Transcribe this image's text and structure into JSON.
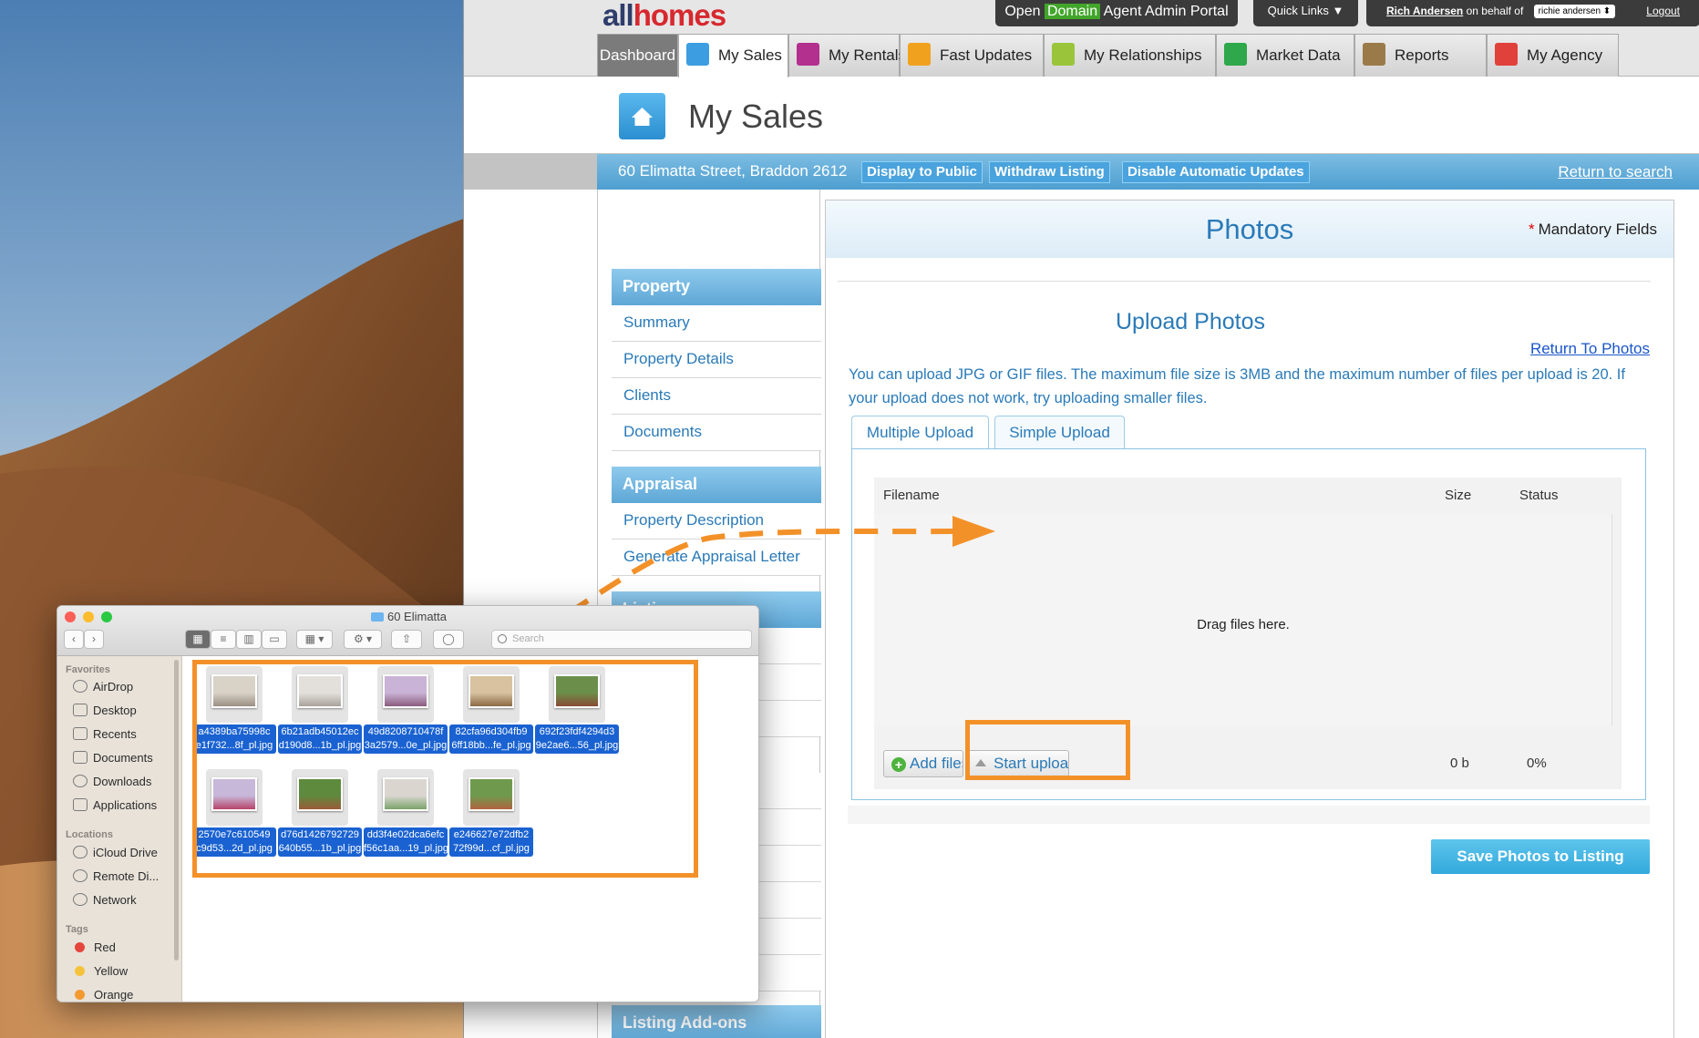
{
  "colors": {
    "accent": "#2a7ab8",
    "highlight": "#f39129",
    "brand_red": "#d7282f",
    "brand_navy": "#2f3d6b",
    "domain_green": "#41a62a",
    "selection_blue": "#1a62d1"
  },
  "brand": {
    "part1": "all",
    "part2": "homes"
  },
  "topbar": {
    "open": "Open",
    "domain": "Domain",
    "portal_rest": " Agent Admin Portal",
    "quick_links": "Quick Links ▼",
    "user": "Rich Andersen",
    "on_behalf": " on behalf of",
    "selected_user": "richie andersen ⬍",
    "logout": "Logout"
  },
  "tabs": [
    {
      "label": "Dashboard",
      "icon": "none"
    },
    {
      "label": "My Sales",
      "icon": "house-icon"
    },
    {
      "label": "My Rentals",
      "icon": "rentals-icon"
    },
    {
      "label": "Fast Updates",
      "icon": "lightning-icon"
    },
    {
      "label": "My Relationships",
      "icon": "people-icon"
    },
    {
      "label": "Market Data",
      "icon": "pie-chart-icon"
    },
    {
      "label": "Reports",
      "icon": "report-icon"
    },
    {
      "label": "My Agency",
      "icon": "agency-icon"
    }
  ],
  "page_title": "My Sales",
  "address_bar": {
    "address": "60 Elimatta Street, Braddon 2612",
    "display_public": "Display to Public",
    "withdraw": "Withdraw Listing",
    "disable_updates": "Disable Automatic Updates",
    "return_search": "Return to search"
  },
  "left_nav": {
    "property_header": "Property",
    "property_items": [
      "Summary",
      "Property Details",
      "Clients",
      "Documents"
    ],
    "appraisal_header": "Appraisal",
    "appraisal_items": [
      "Property Description",
      "Generate Appraisal Letter"
    ],
    "listing_header": "Listing",
    "addons_header": "Listing Add-ons"
  },
  "photos_panel": {
    "title": "Photos",
    "mandatory": "Mandatory Fields",
    "upload_title": "Upload Photos",
    "return_photos": "Return To Photos",
    "info": "You can upload JPG or GIF files. The maximum file size is 3MB and the maximum number of files per upload is 20. If your upload does not work, try uploading smaller files.",
    "tab_multiple": "Multiple Upload",
    "tab_simple": "Simple Upload",
    "col_filename": "Filename",
    "col_size": "Size",
    "col_status": "Status",
    "drag_text": "Drag files here.",
    "add_files": "Add files",
    "start_upload": "Start upload",
    "total_size": "0 b",
    "total_status": "0%",
    "save_button": "Save Photos to Listing"
  },
  "finder": {
    "title": "60 Elimatta",
    "search_placeholder": "Search",
    "favorites_header": "Favorites",
    "favorites": [
      "AirDrop",
      "Desktop",
      "Recents",
      "Documents",
      "Downloads",
      "Applications"
    ],
    "locations_header": "Locations",
    "locations": [
      "iCloud Drive",
      "Remote Di...",
      "Network"
    ],
    "tags_header": "Tags",
    "tags": [
      {
        "name": "Red",
        "color": "#e5453d"
      },
      {
        "name": "Yellow",
        "color": "#f5c33b"
      },
      {
        "name": "Orange",
        "color": "#f39a2f"
      }
    ],
    "files": [
      {
        "line1": "a4389ba75998c",
        "line2": "e1f732...8f_pl.jpg",
        "c1": "#d9d2c7",
        "c2": "#9a8f82"
      },
      {
        "line1": "6b21adb45012ec",
        "line2": "d190d8...1b_pl.jpg",
        "c1": "#e3e0dc",
        "c2": "#a8a29a"
      },
      {
        "line1": "49d8208710478f",
        "line2": "3a2579...0e_pl.jpg",
        "c1": "#c9b3d6",
        "c2": "#8a5b7d"
      },
      {
        "line1": "82cfa96d304fb9",
        "line2": "6ff18bb...fe_pl.jpg",
        "c1": "#d8c29f",
        "c2": "#8b6a45"
      },
      {
        "line1": "692f23fdf4294d3",
        "line2": "9e2ae6...56_pl.jpg",
        "c1": "#6b8f4a",
        "c2": "#8a4b35"
      },
      {
        "line1": "2570e7c610549",
        "line2": "c9d53...2d_pl.jpg",
        "c1": "#c7b7d9",
        "c2": "#b8436a"
      },
      {
        "line1": "d76d1426792729",
        "line2": "640b55...1b_pl.jpg",
        "c1": "#5e8a3d",
        "c2": "#9b5a38"
      },
      {
        "line1": "dd3f4e02dca6efc",
        "line2": "f56c1aa...19_pl.jpg",
        "c1": "#dad6cf",
        "c2": "#7aa36a"
      },
      {
        "line1": "e246627e72dfb2",
        "line2": "72f99d...cf_pl.jpg",
        "c1": "#6f9a4e",
        "c2": "#b0633e"
      }
    ]
  }
}
